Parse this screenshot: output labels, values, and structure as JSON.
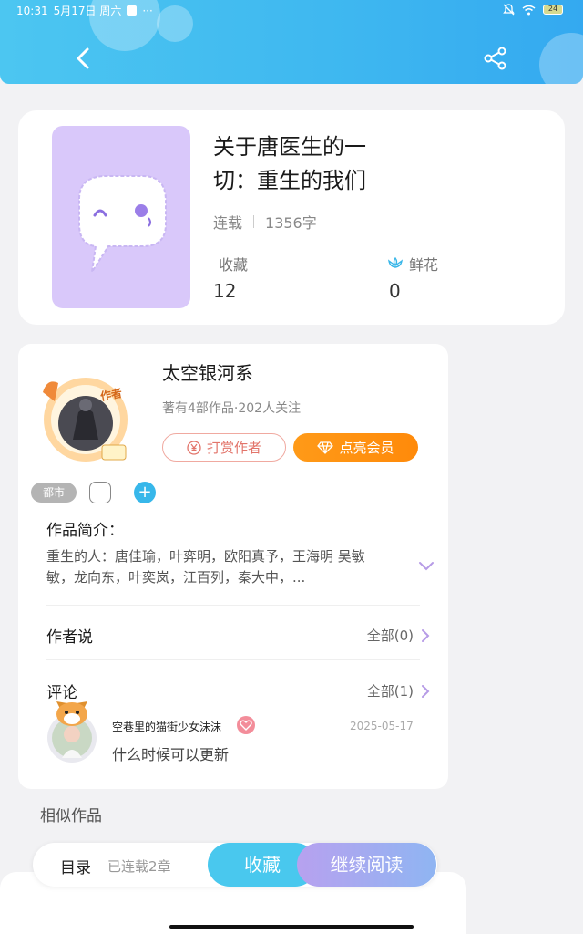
{
  "status_bar": {
    "time": "10:31",
    "date": "5月17日 周六",
    "more": "···",
    "battery": "24"
  },
  "book": {
    "title": "关于唐医生的一切：重生的我们",
    "status": "连载",
    "word_count": "1356字",
    "favorites_label": "收藏",
    "favorites_count": "12",
    "flowers_label": "鲜花",
    "flowers_count": "0"
  },
  "author": {
    "name": "太空银河系",
    "summary": "著有4部作品·202人关注",
    "avatar_badge": "作者",
    "tip_label": "打赏作者",
    "vip_label": "点亮会员"
  },
  "tags": [
    "都市"
  ],
  "intro": {
    "title": "作品简介：",
    "text": "重生的人：唐佳瑜，叶弈明，欧阳真予，王海明 吴敏敏，龙向东，叶奕岚，江百列，秦大中，..."
  },
  "author_says": {
    "title": "作者说",
    "link": "全部(0)"
  },
  "comments": {
    "title": "评论",
    "link": "全部(1)",
    "items": [
      {
        "user": "空巷里的猫街少女沫沫",
        "date": "2025-05-17",
        "text": "什么时候可以更新"
      }
    ]
  },
  "similar_title": "相似作品",
  "bottom_bar": {
    "toc_label": "目录",
    "chapters_label": "已连载2章",
    "favorite_button": "收藏",
    "continue_button": "继续阅读"
  },
  "colors": {
    "header": "#3eb7f0",
    "accent": "#49c8ee",
    "vip": "#ff9a18",
    "tip": "#e2746a"
  }
}
